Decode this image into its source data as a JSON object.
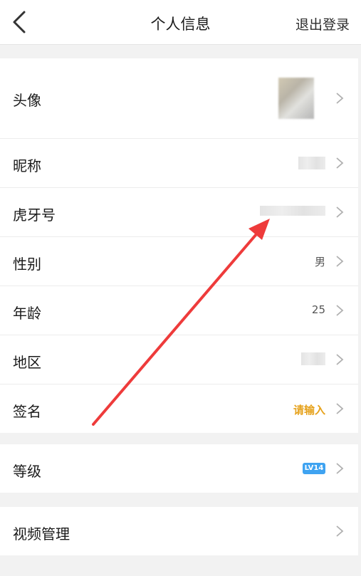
{
  "header": {
    "back_icon": "chevron-left-icon",
    "title": "个人信息",
    "logout": "退出登录"
  },
  "profile": {
    "avatar_label": "头像",
    "nickname_label": "昵称",
    "huya_id_label": "虎牙号",
    "gender_label": "性别",
    "gender_value": "男",
    "age_label": "年龄",
    "age_value": "25",
    "region_label": "地区",
    "signature_label": "签名",
    "signature_placeholder": "请输入"
  },
  "level": {
    "label": "等级",
    "badge": "LV14"
  },
  "video": {
    "label": "视频管理"
  },
  "colors": {
    "background": "#f2f2f2",
    "accent_orange": "#e6a21c",
    "badge_blue": "#3fa3f1",
    "annotation_arrow": "#ee3b3b"
  }
}
